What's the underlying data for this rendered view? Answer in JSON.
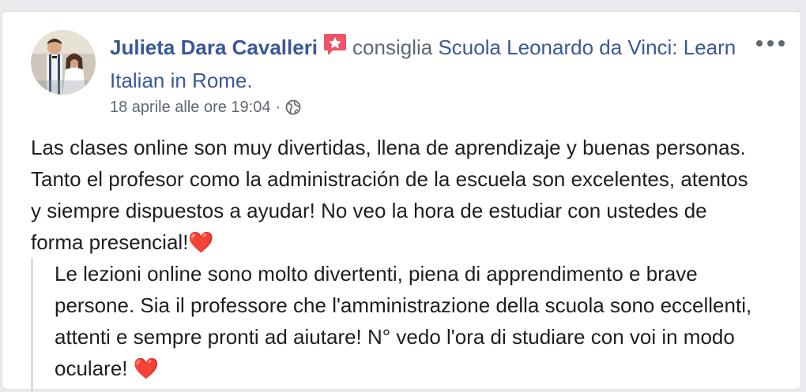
{
  "post": {
    "author": "Julieta Dara Cavalleri",
    "action": "consiglia",
    "page_name": "Scuola Leonardo da Vinci: Learn Italian in Rome.",
    "timestamp": "18 aprile alle ore 19:04",
    "separator": "·",
    "privacy_icon": "globe-icon",
    "recommend_icon": "recommendation-star-icon",
    "more_icon": "more-options-icon",
    "body": "Las clases online son muy divertidas, llena de aprendizaje y buenas personas. Tanto el profesor como la administración de la escuela son excelentes, atentos y siempre dispuestos a ayudar! No veo la hora de estudiar con ustedes de forma presencial!",
    "body_emoji": "❤️",
    "translation": "Le lezioni online sono molto divertenti, piena di apprendimento e brave persone. Sia il professore che l'amministrazione della scuola sono eccellenti, attenti e sempre pronti ad aiutare! N° vedo l'ora di studiare con voi in modo oculare!",
    "translation_emoji": "❤️"
  },
  "colors": {
    "link": "#385898",
    "meta": "#606770",
    "text": "#1c1e21",
    "badge": "#f25268",
    "heart": "#e02d3c"
  }
}
